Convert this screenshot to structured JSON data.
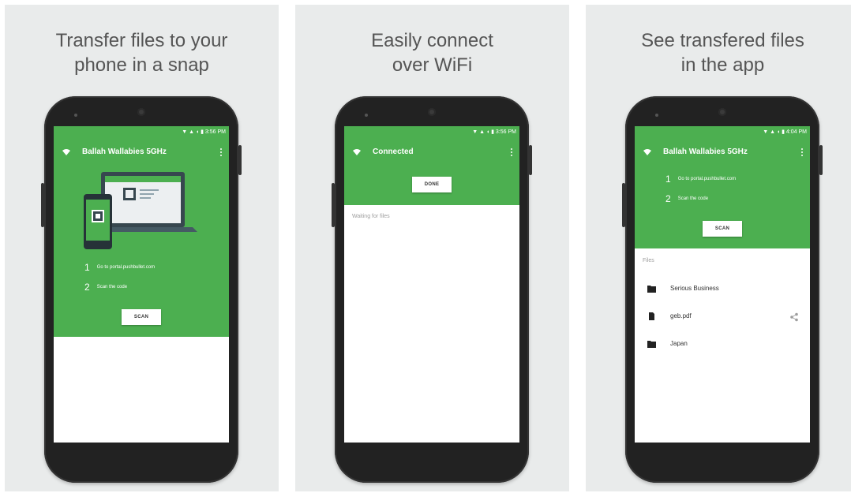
{
  "panels": [
    {
      "caption": [
        "Transfer files to your",
        "phone in a snap"
      ],
      "status": "▼ ▲ ◖ ▮ 3:56 PM",
      "toolbar_title": "Ballah Wallabies 5GHz",
      "steps": [
        {
          "num": "1",
          "text": "Go to portal.pushbullet.com"
        },
        {
          "num": "2",
          "text": "Scan the code"
        }
      ],
      "button": "SCAN"
    },
    {
      "caption": [
        "Easily connect",
        "over WiFi"
      ],
      "status": "▼ ▲ ◖ ▮ 3:56 PM",
      "toolbar_title": "Connected",
      "button": "DONE",
      "waiting": "Waiting for files"
    },
    {
      "caption": [
        "See transfered files",
        "in the app"
      ],
      "status": "▼ ▲ ◖ ▮ 4:04 PM",
      "toolbar_title": "Ballah Wallabies 5GHz",
      "steps": [
        {
          "num": "1",
          "text": "Go to portal.pushbullet.com"
        },
        {
          "num": "2",
          "text": "Scan the code"
        }
      ],
      "button": "SCAN",
      "files_header": "Files",
      "files": [
        {
          "name": "Serious Business",
          "icon": "folder-icon"
        },
        {
          "name": "geb.pdf",
          "icon": "file-icon"
        },
        {
          "name": "Japan",
          "icon": "folder-icon"
        }
      ]
    }
  ],
  "colors": {
    "accent": "#4caf50",
    "background": "#e9ebeb",
    "phone": "#222222"
  }
}
